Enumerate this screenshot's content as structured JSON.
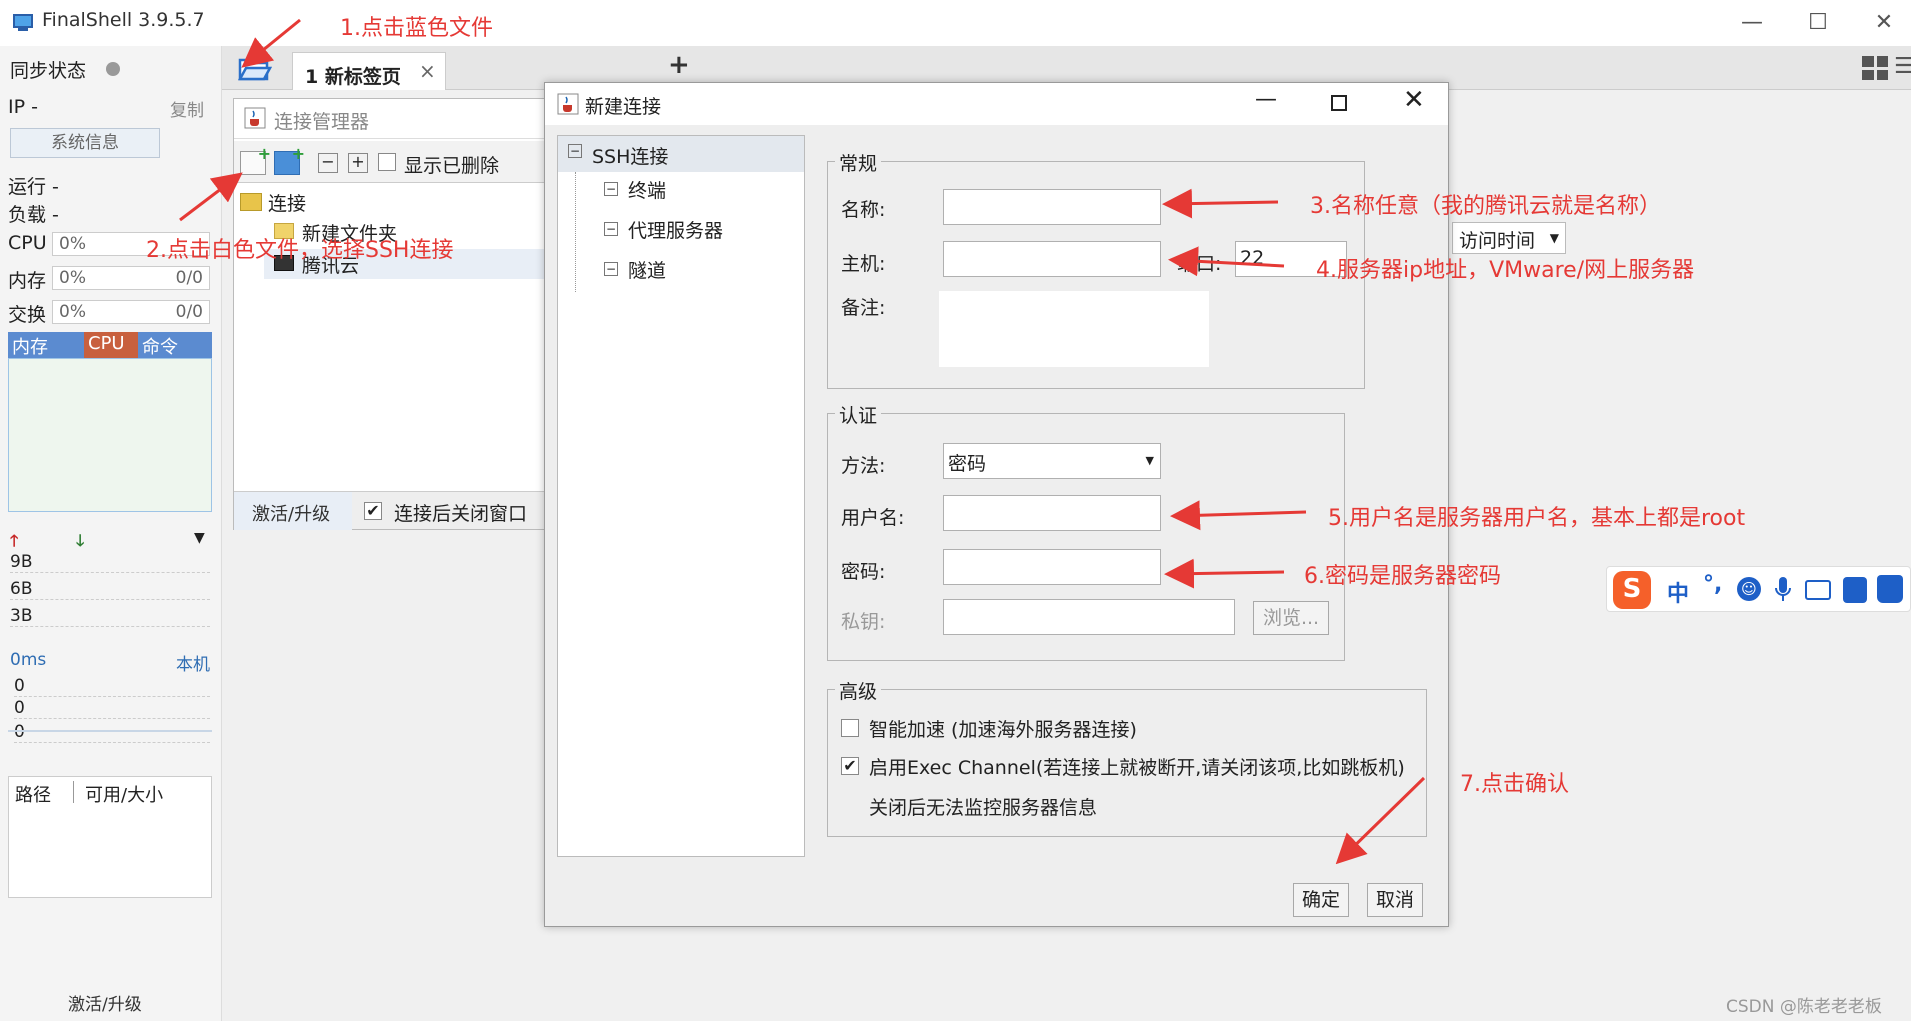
{
  "app": {
    "title": "FinalShell 3.9.5.7"
  },
  "left_panel": {
    "sync_label": "同步状态",
    "ip_label": "IP  -",
    "copy_label": "复制",
    "sysinfo_button": "系统信息",
    "run_label": "运行 -",
    "load_label": "负载 -",
    "cpu_label": "CPU",
    "cpu_value": "0%",
    "mem_label": "内存",
    "mem_value": "0%",
    "mem_ratio": "0/0",
    "swap_label": "交换",
    "swap_value": "0%",
    "swap_ratio": "0/0",
    "tabs": [
      "内存",
      "CPU",
      "命令"
    ],
    "net_values": [
      "9B",
      "6B",
      "3B"
    ],
    "ping_label": "0ms",
    "local_label": "本机",
    "ping_values": [
      "0",
      "0",
      "0"
    ],
    "path_label": "路径",
    "avail_label": "可用/大小",
    "activate_label": "激活/升级"
  },
  "tabs": {
    "tab1_label": "1 新标签页",
    "close_glyph": "×",
    "add_glyph": "+"
  },
  "conn_manager": {
    "title": "连接管理器",
    "show_deleted": "显示已删除",
    "tree_root": "连接",
    "tree_folder": "新建文件夹",
    "tree_item": "腾讯云",
    "activate": "激活/升级",
    "close_after": "连接后关闭窗口"
  },
  "right_area": {
    "sort_dropdown": "访问时间"
  },
  "dialog": {
    "title": "新建连接",
    "nav": [
      "SSH连接",
      "终端",
      "代理服务器",
      "隧道"
    ],
    "general_legend": "常规",
    "name_label": "名称:",
    "host_label": "主机:",
    "port_label": "端口:",
    "port_value": "22",
    "note_label": "备注:",
    "auth_legend": "认证",
    "method_label": "方法:",
    "method_value": "密码",
    "username_label": "用户名:",
    "password_label": "密码:",
    "privkey_label": "私钥:",
    "browse_button": "浏览...",
    "advanced_legend": "高级",
    "smart_accel": "智能加速 (加速海外服务器连接)",
    "exec_channel": "启用Exec Channel(若连接上就被断开,请关闭该项,比如跳板机)",
    "exec_note": "关闭后无法监控服务器信息",
    "ok_button": "确定",
    "cancel_button": "取消"
  },
  "annotations": {
    "a1": "1.点击蓝色文件",
    "a2": "2.点击白色文件，选择SSH连接",
    "a3": "3.名称任意（我的腾讯云就是名称）",
    "a4": "4.服务器ip地址，VMware/网上服务器",
    "a5": "5.用户名是服务器用户名，基本上都是root",
    "a6": "6.密码是服务器密码",
    "a7": "7.点击确认"
  },
  "ime": {
    "zh": "中",
    "punct": "°,"
  },
  "watermark": "CSDN @陈老老老板",
  "colors": {
    "annotation": "#e53935",
    "tab_mem": "#5b8bd0",
    "tab_cpu": "#c8603e",
    "graph_bg": "#eef6ee"
  }
}
